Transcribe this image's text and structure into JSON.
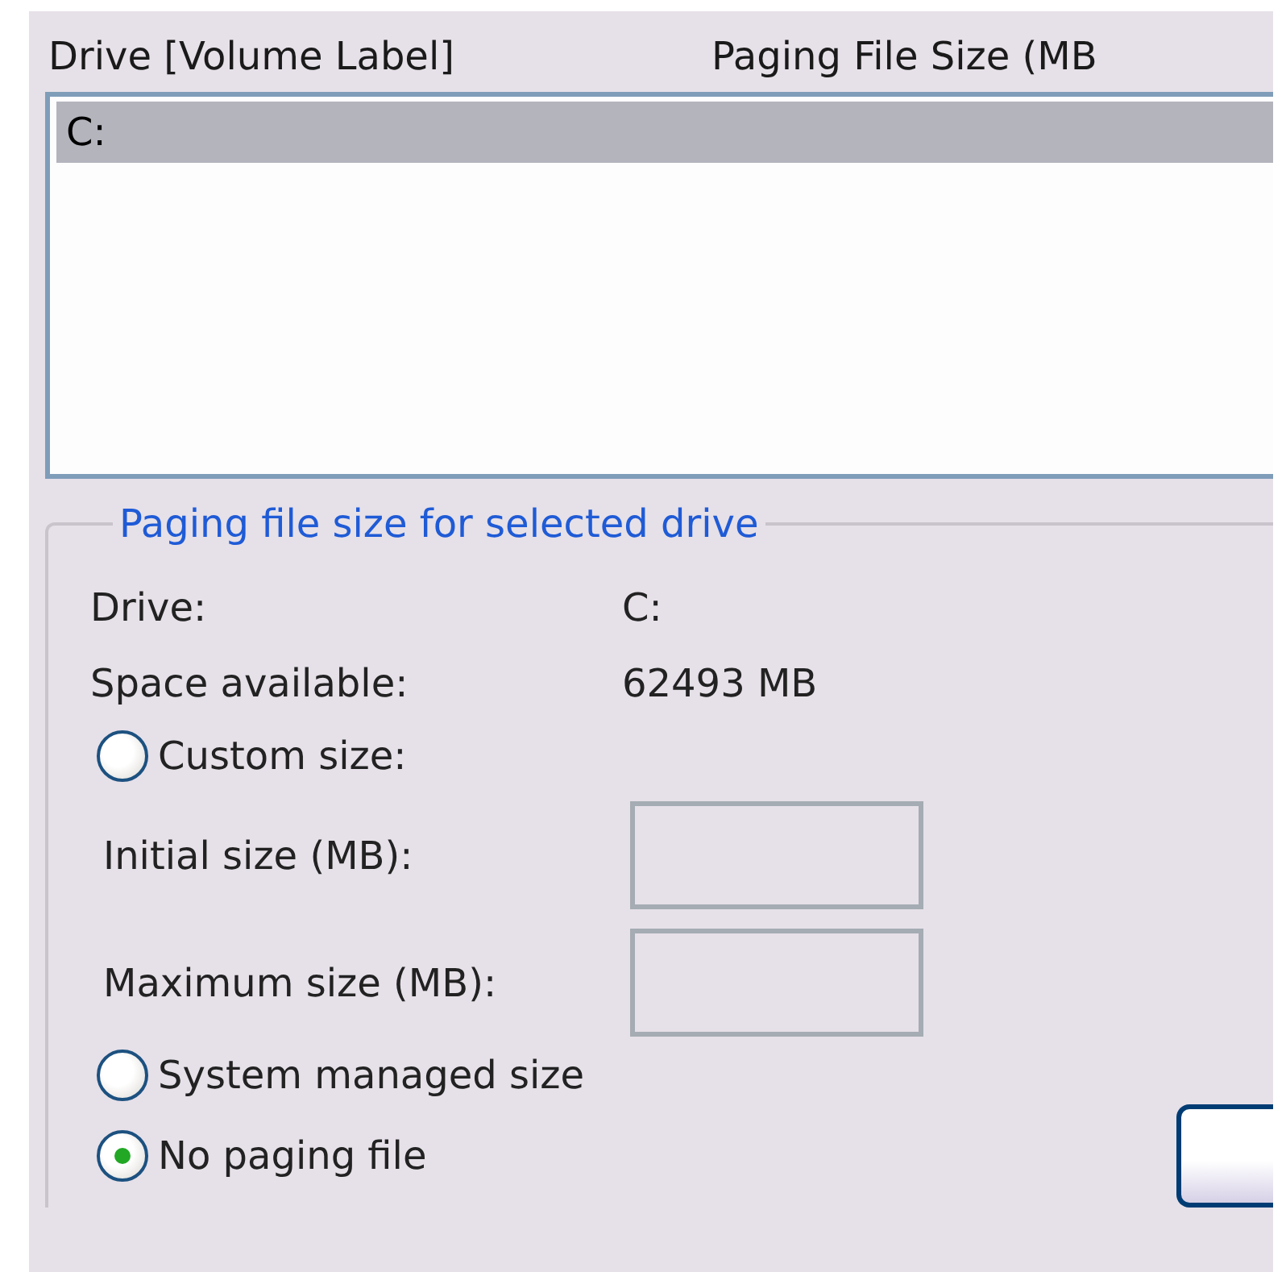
{
  "list_header": {
    "columns": [
      "Drive  [Volume Label]",
      "Paging File Size (MB"
    ]
  },
  "drives": [
    {
      "drive": "C:",
      "selected": true
    }
  ],
  "group": {
    "title": "Paging file size for selected drive",
    "info": [
      {
        "label": "Drive:",
        "value": "C:"
      },
      {
        "label": "Space available:",
        "value": "62493 MB"
      }
    ],
    "options": [
      {
        "label": "Custom size:",
        "selected": false
      },
      {
        "label": "System managed size",
        "selected": false
      },
      {
        "label": "No paging file",
        "selected": true
      }
    ],
    "fields": [
      {
        "label": "Initial size (MB):"
      },
      {
        "label": "Maximum size (MB):"
      }
    ]
  }
}
